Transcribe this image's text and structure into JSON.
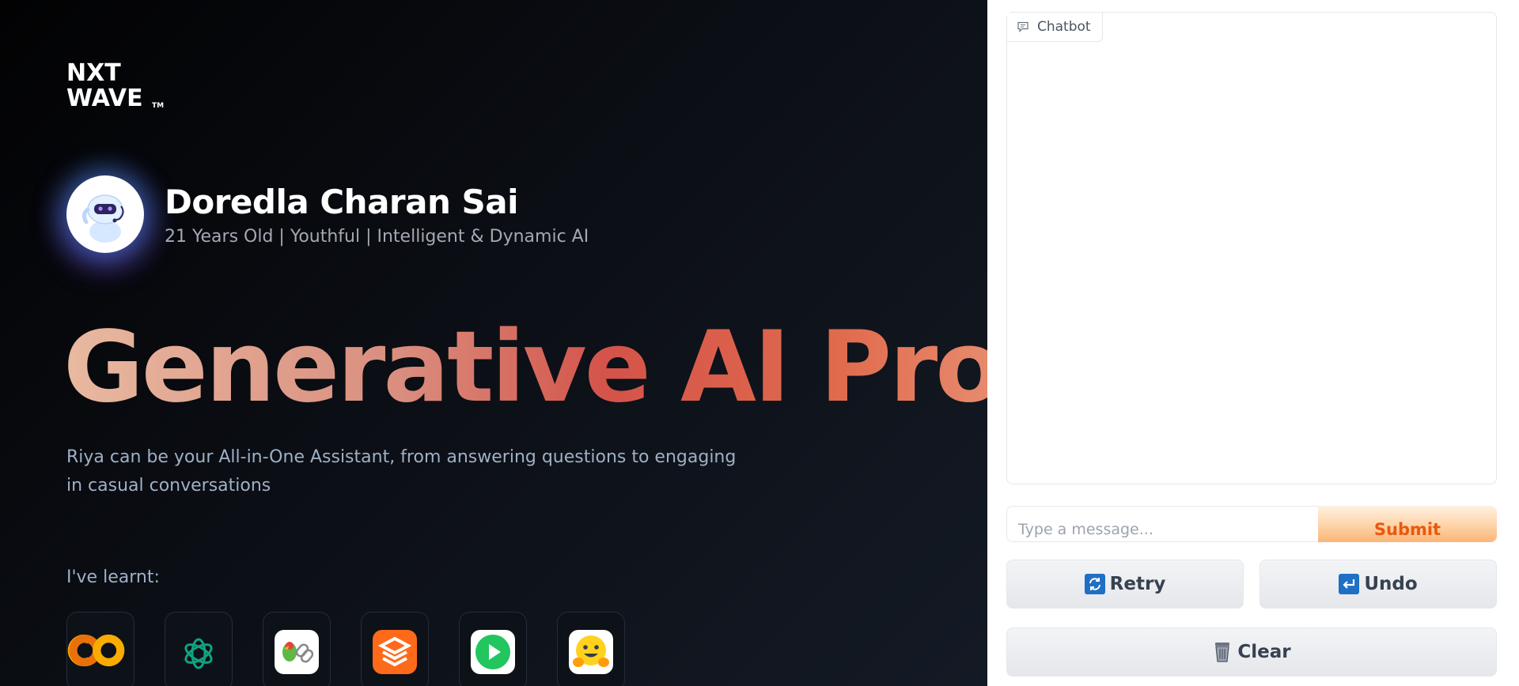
{
  "brand": {
    "line1": "NXT",
    "line2": "WAVE",
    "tm": "TM"
  },
  "profile": {
    "name": "Doredla Charan Sai",
    "tagline": "21 Years Old | Youthful | Intelligent & Dynamic AI"
  },
  "hero": {
    "title": "Generative AI Project"
  },
  "description": "Riya can be your All-in-One Assistant, from answering questions to engaging in casual conversations",
  "learnt": {
    "label": "I've learnt:",
    "tools": [
      "google-colab-icon",
      "openai-icon",
      "langchain-icon",
      "orange-layers-icon",
      "play-icon",
      "huggingface-icon"
    ]
  },
  "chat": {
    "label": "Chatbot",
    "input_placeholder": "Type a message...",
    "submit_label": "Submit",
    "retry_label": "Retry",
    "undo_label": "Undo",
    "clear_label": "Clear"
  },
  "colors": {
    "accent": "#ea580c",
    "submit_bg": "#fdd3a6",
    "hero_gradient": [
      "#e8b9a0",
      "#d4534a",
      "#f0b49a"
    ]
  }
}
